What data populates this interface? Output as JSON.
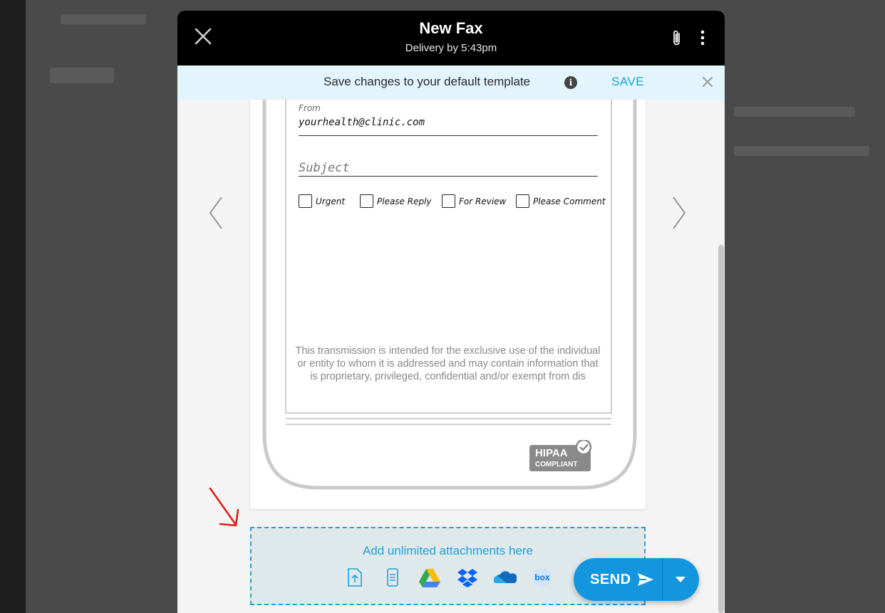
{
  "header": {
    "title": "New Fax",
    "subtitle": "Delivery by 5:43pm"
  },
  "banner": {
    "text": "Save changes to your default template",
    "info_glyph": "i",
    "save_label": "SAVE"
  },
  "cover_page": {
    "from_label": "From",
    "from_value": "yourhealth@clinic.com",
    "subject_placeholder": "Subject",
    "checkboxes": [
      {
        "label": "Urgent",
        "checked": false
      },
      {
        "label": "Please Reply",
        "checked": false
      },
      {
        "label": "For Review",
        "checked": false
      },
      {
        "label": "Please Comment",
        "checked": false
      }
    ],
    "disclaimer": "This transmission is intended for the exclusive use of the individual or entity to whom it is addressed and may contain information that is proprietary, privileged, confidential and/or exempt from dis",
    "badge": {
      "line1": "HIPAA",
      "line2": "COMPLIANT"
    }
  },
  "attachments": {
    "prompt": "Add unlimited attachments here",
    "sources": [
      "upload-icon",
      "scan-icon",
      "google-drive-icon",
      "dropbox-icon",
      "onedrive-icon",
      "box-icon"
    ],
    "box_label": "box"
  },
  "send": {
    "label": "SEND"
  },
  "colors": {
    "accent": "#1ea1d8",
    "send": "#1496de",
    "banner_bg": "#e3f5fc",
    "header_bg": "#000000",
    "arrow": "#e02020"
  }
}
